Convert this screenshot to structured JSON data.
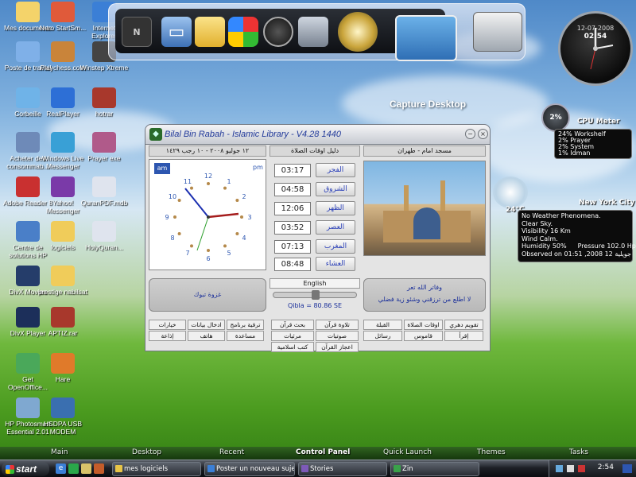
{
  "desktop_icons": [
    {
      "label": "Mes documents",
      "icon": "folder-documents-icon"
    },
    {
      "label": "Nero StartSm...",
      "icon": "nero-icon"
    },
    {
      "label": "Internet Explorer",
      "icon": "internet-explorer-icon"
    },
    {
      "label": "Poste de travail",
      "icon": "computer-icon"
    },
    {
      "label": "Playchess.com",
      "icon": "chess-icon"
    },
    {
      "label": "Winstep Xtreme",
      "icon": "winstep-icon"
    },
    {
      "label": "Corbeille",
      "icon": "recycle-bin-icon"
    },
    {
      "label": "RealPlayer",
      "icon": "realplayer-icon"
    },
    {
      "label": "hotrar",
      "icon": "winrar-icon"
    },
    {
      "label": "Acheter des consommab...",
      "icon": "printer-shop-icon"
    },
    {
      "label": "Windows Live Messenger",
      "icon": "messenger-icon"
    },
    {
      "label": "Prayer exe",
      "icon": "prayer-icon"
    },
    {
      "label": "Adobe Reader 8",
      "icon": "adobe-reader-icon"
    },
    {
      "label": "Yahoo! Messenger",
      "icon": "yahoo-icon"
    },
    {
      "label": "QuranPDF.mdb",
      "icon": "pdf-file-icon"
    },
    {
      "label": "Centre de solutions HP",
      "icon": "hp-solution-icon"
    },
    {
      "label": "logiciels",
      "icon": "folder-icon"
    },
    {
      "label": "HolyQuran...",
      "icon": "pdf-file-icon"
    },
    {
      "label": "DivX Movies",
      "icon": "divx-icon"
    },
    {
      "label": "prestige nabilsat",
      "icon": "folder-icon"
    },
    {
      "label": "DivX Player",
      "icon": "divx-player-icon"
    },
    {
      "label": "APTIZ.rar",
      "icon": "winrar-icon"
    },
    {
      "label": "Get OpenOffice...",
      "icon": "openoffice-icon"
    },
    {
      "label": "Hare",
      "icon": "hare-icon"
    },
    {
      "label": "HP Photosmart Essential 2.01",
      "icon": "hp-photosmart-icon"
    },
    {
      "label": "HSDPA USB MODEM",
      "icon": "modem-icon"
    }
  ],
  "dock": {
    "items": [
      "nexus-logo-icon",
      "computer-icon",
      "folder-icon",
      "windows-icon",
      "clock-icon",
      "recycle-bin-icon",
      "network-globe-icon",
      "capture-camera-icon",
      "clock-app-icon"
    ],
    "capture_label": "Capture Desktop"
  },
  "clock_widget": {
    "date": "12-07-2008",
    "time": "02:54"
  },
  "cpu_meter": {
    "title": "CPU Meter",
    "percent": "2%",
    "processes": [
      "24% Workshelf",
      "2% Prayer",
      "2% System",
      "1% Idman"
    ]
  },
  "weather": {
    "city": "New York City",
    "temp": "24°C",
    "lines": [
      "No Weather Phenomena.",
      "Clear Sky.",
      "Visibility 16 Km",
      "Wind Calm.",
      "Humidity 50%",
      "Observed on 01:51 ,2008 12 جويلية"
    ],
    "pressure": "Pressure 102.0 Hpa"
  },
  "app": {
    "title": "Bilal Bin Rabah - Islamic Library - V4.28 1440",
    "date_line": "١٢ جوليو ٢٠٠٨ - ١٠ رجب ١٤٢٩",
    "prayer_header": "دليل اوقات الصلاة",
    "mosque_header": "مسجد امام - طهران",
    "clock_am": "am",
    "clock_pm": "pm",
    "clock_numbers": [
      "12",
      "1",
      "2",
      "3",
      "4",
      "5",
      "6",
      "7",
      "8",
      "9",
      "10",
      "11"
    ],
    "prayers": [
      {
        "time": "03:17",
        "name": "الفجر"
      },
      {
        "time": "04:58",
        "name": "الشروق"
      },
      {
        "time": "12:06",
        "name": "الظهر"
      },
      {
        "time": "03:52",
        "name": "العصر"
      },
      {
        "time": "07:13",
        "name": "المغرب"
      },
      {
        "time": "08:48",
        "name": "العشاء"
      }
    ],
    "language": "English",
    "qibla": "Qibla = 80.86 SE",
    "left_info": "غزوة تبوك",
    "right_info_title": "وفاتر الله تعر",
    "right_info_body": "لا اطلع من ترزقني وشئو زية فضلي",
    "left_buttons": [
      "خيارات",
      "ادخال بيانات",
      "ترقية برنامج",
      "إذاعة",
      "هاتف",
      "مساعدة"
    ],
    "mid_buttons": [
      "بحث قرآن",
      "تلاوة قرآن",
      "مرئيات",
      "صوتيات",
      "كتب اسلامية",
      "اعجاز القرآن"
    ],
    "right_buttons": [
      "القبلة",
      "اوقات الصلاة",
      "تقويم دهري",
      "رسائل",
      "قاموس",
      "إقرأ"
    ]
  },
  "bottom_menu": [
    "Main",
    "Desktop",
    "Recent",
    "Control Panel",
    "Quick Launch",
    "Themes",
    "Tasks"
  ],
  "bottom_menu_active": "Control Panel",
  "taskbar": {
    "start": "start",
    "tasks": [
      "mes logiciels",
      "Poster un nouveau sujet ...",
      "Stories",
      "Zin"
    ],
    "time": "2:54"
  }
}
